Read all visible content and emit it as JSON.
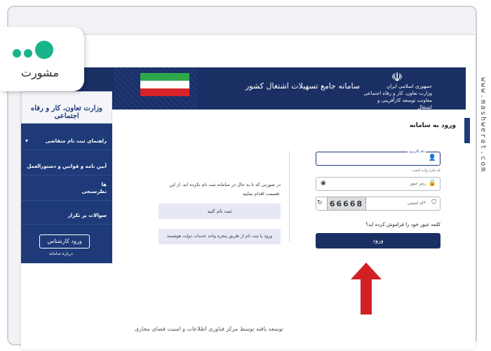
{
  "watermark": "www.mashwerat.com",
  "logo": {
    "word": "مشورت"
  },
  "header": {
    "system_title": "سامانه جامع تسهیلات اشتغال کشور",
    "gov_lines": [
      "جمهوری اسلامی ایران",
      "وزارت تعاون، کار و رفاه اجتماعی",
      "معاونت توسعه کارآفرینی و اشتغال"
    ]
  },
  "sidebar": {
    "ministry": "وزارت تعاون، کار و رفاه اجتماعی",
    "items": [
      {
        "label": "راهنمای ثبت نام متقاضی"
      },
      {
        "label": "آیین نامه و قوانین و دستورالعمل ها"
      },
      {
        "label": "نظرسنجی"
      },
      {
        "label": "سوالات پر تکرار"
      }
    ],
    "expert_button": "ورود کارشناس",
    "footer": "درباره سامانه"
  },
  "login": {
    "title": "ورود به سامانه",
    "username_label": "نام کاربری",
    "username_hint": "کد ملی/ واژه کسب",
    "password_placeholder": "رمز عبور",
    "captcha_placeholder": "کد امنیتی*",
    "captcha_value": "66668",
    "forgot_link": "کلمه عبور خود را فراموش کرده اید؟",
    "submit": "ورود"
  },
  "register": {
    "text": "در صورتی که تا به حال در سامانه ثبت نام نکرده اید، از این قسمت اقدام نمایید.",
    "button": "ثبت نام کنید",
    "gov_button": "ورود یا ثبت نام از طریق پنجره واحد خدمات دولت هوشمند"
  },
  "footer": {
    "text": "توسعه یافته توسط مرکز فناوری اطلاعات و امنیت فضای مجازی"
  },
  "colors": {
    "navy": "#1a2f63",
    "sidebar": "#1e3a78",
    "accent_arrow": "#d11f24",
    "logo_green": "#19b38a"
  }
}
